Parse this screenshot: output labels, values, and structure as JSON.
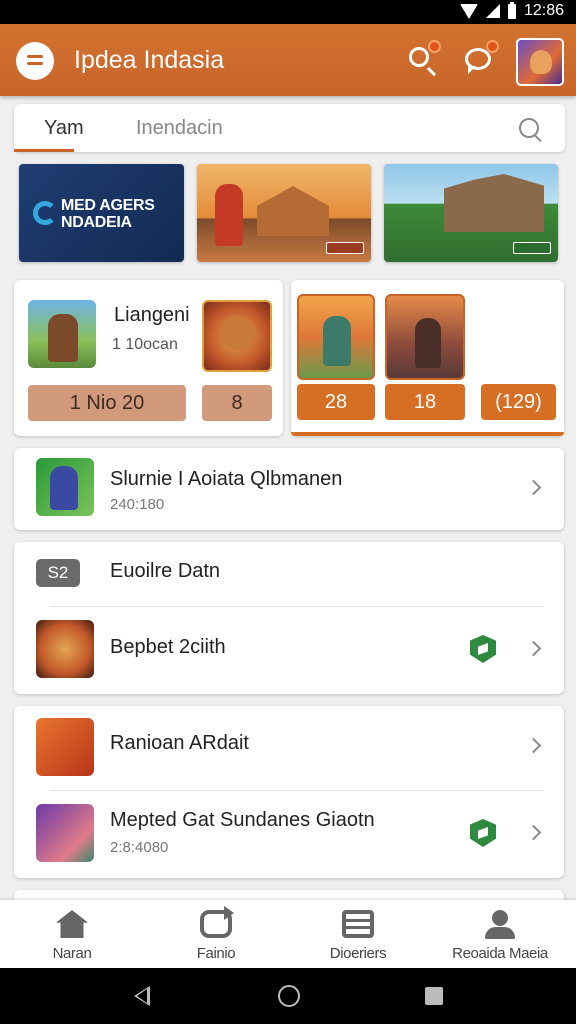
{
  "status_bar": {
    "time": "12:86"
  },
  "app_bar": {
    "title": "Ipdea Indasia",
    "icons": [
      "menu-icon",
      "search-icon",
      "chat-icon",
      "avatar"
    ]
  },
  "search": {
    "tab_label": "Yam",
    "placeholder": "Inendacin"
  },
  "banners": [
    {
      "text": "MED AGERS NDADEIA"
    },
    {
      "text": ""
    },
    {
      "text": ""
    }
  ],
  "featured": {
    "title": "Liangeni",
    "meta": "1 10ocan",
    "pill_1": "1   Nio   20",
    "pill_2": "8",
    "buttons": [
      "28",
      "18",
      "(129)"
    ]
  },
  "list": [
    {
      "title": "Slurnie I Aoiata Qlbmanen",
      "subtitle": "240:180",
      "chevron": true
    },
    {
      "badge": "S2",
      "title": "Euoilre Datn"
    },
    {
      "title": "Bepbet 2ciith",
      "verified": true,
      "chevron": true
    },
    {
      "title": "Ranioan ARdait",
      "chevron": true
    },
    {
      "title": "Mepted Gat Sundanes Giaotn",
      "subtitle": "2:8:4080",
      "verified": true,
      "chevron": true
    }
  ],
  "bottom_nav": [
    {
      "label": "Naran",
      "icon": "home-icon"
    },
    {
      "label": "Fainio",
      "icon": "share-icon"
    },
    {
      "label": "Dioeriers",
      "icon": "list-icon"
    },
    {
      "label": "Reoaida Maeia",
      "icon": "profile-icon"
    }
  ],
  "colors": {
    "accent": "#c8642a",
    "button_orange": "#d66f24",
    "pill": "#d29a7c",
    "verified": "#2f8a3f"
  }
}
